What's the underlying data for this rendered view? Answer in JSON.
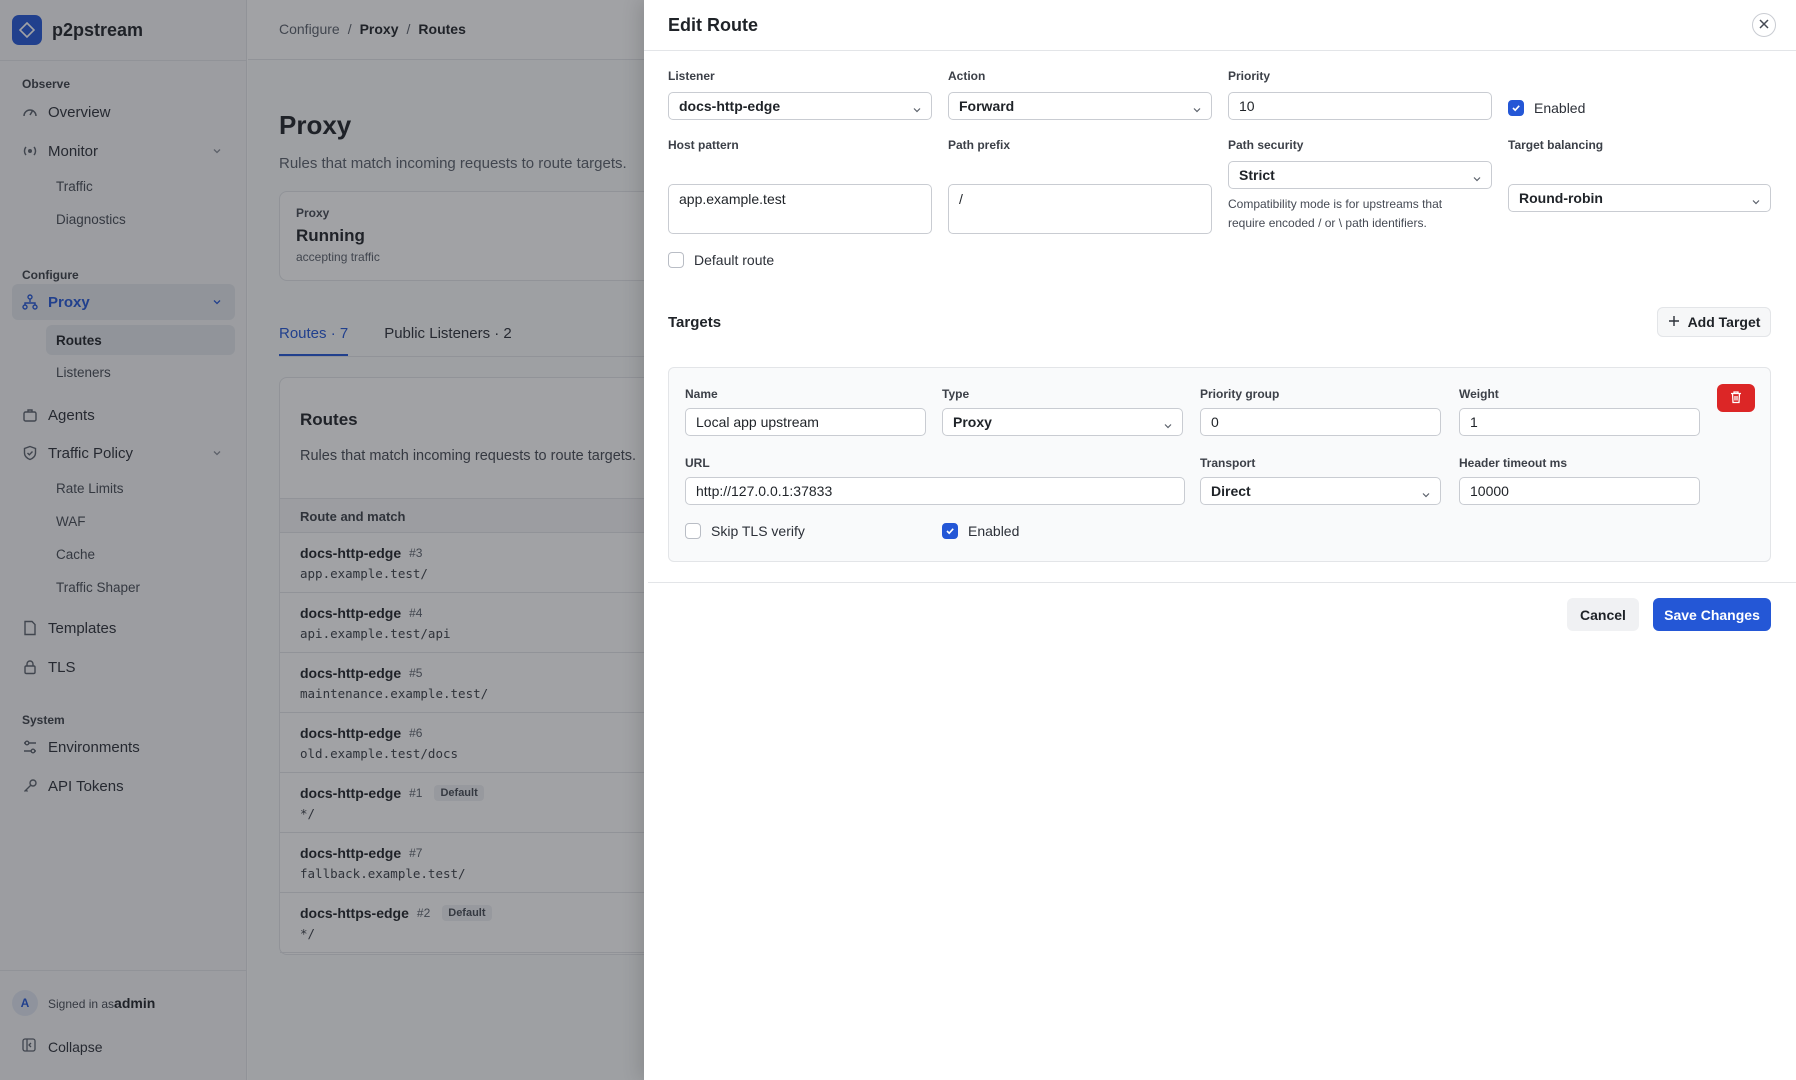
{
  "app": {
    "name": "p2pstream"
  },
  "sidebar": {
    "sections": [
      {
        "label": "Observe"
      },
      {
        "label": "Configure"
      },
      {
        "label": "System"
      }
    ],
    "items": {
      "overview": "Overview",
      "monitor": "Monitor",
      "traffic": "Traffic",
      "diagnostics": "Diagnostics",
      "proxy": "Proxy",
      "routes": "Routes",
      "listeners": "Listeners",
      "agents": "Agents",
      "traffic_policy": "Traffic Policy",
      "rate_limits": "Rate Limits",
      "waf": "WAF",
      "cache": "Cache",
      "traffic_shaper": "Traffic Shaper",
      "templates": "Templates",
      "tls": "TLS",
      "environments": "Environments",
      "api_tokens": "API Tokens"
    },
    "user": {
      "avatar": "A",
      "prefix": "Signed in as",
      "name": "admin"
    },
    "collapse": "Collapse"
  },
  "breadcrumb": [
    "Configure",
    "/",
    "Proxy",
    "/",
    "Routes"
  ],
  "page": {
    "title": "Proxy",
    "description": "Rules that match incoming requests to route targets.",
    "status": {
      "label": "Proxy",
      "value": "Running",
      "sub": "accepting traffic"
    },
    "tabs": [
      "Routes · 7",
      "Public Listeners · 2"
    ],
    "routes_card": {
      "title": "Routes",
      "description": "Rules that match incoming requests to route targets.",
      "column": "Route and match",
      "rows": [
        {
          "name": "docs-http-edge",
          "id": "#3",
          "badge": "",
          "match": "app.example.test/"
        },
        {
          "name": "docs-http-edge",
          "id": "#4",
          "badge": "",
          "match": "api.example.test/api"
        },
        {
          "name": "docs-http-edge",
          "id": "#5",
          "badge": "",
          "match": "maintenance.example.test/"
        },
        {
          "name": "docs-http-edge",
          "id": "#6",
          "badge": "",
          "match": "old.example.test/docs"
        },
        {
          "name": "docs-http-edge",
          "id": "#1",
          "badge": "Default",
          "match": "*/"
        },
        {
          "name": "docs-http-edge",
          "id": "#7",
          "badge": "",
          "match": "fallback.example.test/"
        },
        {
          "name": "docs-https-edge",
          "id": "#2",
          "badge": "Default",
          "match": "*/"
        }
      ]
    }
  },
  "drawer": {
    "title": "Edit Route",
    "listener": {
      "label": "Listener",
      "value": "docs-http-edge"
    },
    "action": {
      "label": "Action",
      "value": "Forward"
    },
    "priority": {
      "label": "Priority",
      "value": "10"
    },
    "enabled": {
      "label": "Enabled",
      "checked": true
    },
    "host_pattern": {
      "label": "Host pattern",
      "value": "app.example.test"
    },
    "path_prefix": {
      "label": "Path prefix",
      "value": "/"
    },
    "path_security": {
      "label": "Path security",
      "value": "Strict",
      "help_line1": "Compatibility mode is for upstreams that",
      "help_line2": "require encoded / or \\ path identifiers."
    },
    "target_balancing": {
      "label": "Target balancing",
      "value": "Round-robin"
    },
    "default_route": {
      "label": "Default route",
      "checked": false
    },
    "targets": {
      "title": "Targets",
      "add_label": "Add Target",
      "items": [
        {
          "name": {
            "label": "Name",
            "value": "Local app upstream"
          },
          "type": {
            "label": "Type",
            "value": "Proxy"
          },
          "priority_group": {
            "label": "Priority group",
            "value": "0"
          },
          "weight": {
            "label": "Weight",
            "value": "1"
          },
          "url": {
            "label": "URL",
            "value": "http://127.0.0.1:37833"
          },
          "transport": {
            "label": "Transport",
            "value": "Direct"
          },
          "header_timeout": {
            "label": "Header timeout ms",
            "value": "10000"
          },
          "skip_tls": {
            "label": "Skip TLS verify",
            "checked": false
          },
          "enabled": {
            "label": "Enabled",
            "checked": true
          }
        }
      ]
    },
    "cancel_label": "Cancel",
    "save_label": "Save Changes"
  },
  "colors": {
    "accent": "#2457d6",
    "danger": "#dc2626"
  }
}
